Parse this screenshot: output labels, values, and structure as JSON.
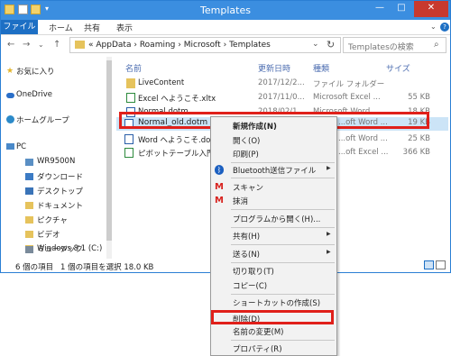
{
  "window": {
    "title": "Templates"
  },
  "ribbon": {
    "tabs": [
      "ファイル",
      "ホーム",
      "共有",
      "表示"
    ]
  },
  "address": {
    "prefix": "«",
    "path": [
      "AppData",
      "Roaming",
      "Microsoft",
      "Templates"
    ],
    "separator": "›"
  },
  "search": {
    "placeholder": "Templatesの検索"
  },
  "nav_pane": {
    "favorites": "お気に入り",
    "onedrive": "OneDrive",
    "homegroup": "ホームグループ",
    "pc": "PC",
    "pc_items": [
      "WR9500N",
      "ダウンロード",
      "デスクトップ",
      "ドキュメント",
      "ピクチャ",
      "ビデオ",
      "ミュージック",
      "Windows 8.1 (C:)"
    ]
  },
  "file_list": {
    "columns": {
      "name": "名前",
      "date": "更新日時",
      "type": "種類",
      "size": "サイズ"
    },
    "rows": [
      {
        "name": "LiveContent",
        "date": "2017/12/2...",
        "type": "ファイル フォルダー",
        "size": "",
        "icon": "folder-icon"
      },
      {
        "name": "Excel へようこそ.xltx",
        "date": "2017/11/0...",
        "type": "Microsoft Excel ...",
        "size": "55 KB",
        "icon": "excel-file-icon"
      },
      {
        "name": "Normal.dotm",
        "date": "2018/02/1...",
        "type": "Microsoft Word ...",
        "size": "18 KB",
        "icon": "word-file-icon"
      },
      {
        "name": "Normal_old.dotm",
        "date": "",
        "type": "...oft Word ...",
        "size": "19 KB",
        "icon": "word-file-icon",
        "selected": true
      },
      {
        "name": "Word へようこそ.dotx",
        "date": "",
        "type": "...oft Word ...",
        "size": "25 KB",
        "icon": "word-file-icon"
      },
      {
        "name": "ピボットテーブル入門.xltx",
        "date": "",
        "type": "...oft Excel ...",
        "size": "366 KB",
        "icon": "excel-file-icon"
      }
    ]
  },
  "status": {
    "count": "6 個の項目",
    "selection": "1 個の項目を選択  18.0 KB"
  },
  "context_menu": {
    "items": [
      {
        "label": "新規作成(N)",
        "bold": true
      },
      {
        "label": "開く(O)"
      },
      {
        "label": "印刷(P)"
      },
      {
        "label": "Bluetooth送信ファイル",
        "submenu": true,
        "icon": "bluetooth-icon"
      },
      {
        "label": "スキャン",
        "icon": "mcafee-icon"
      },
      {
        "label": "抹消",
        "icon": "mcafee-icon"
      },
      {
        "label": "プログラムから開く(H)..."
      },
      {
        "label": "共有(H)",
        "submenu": true
      },
      {
        "label": "送る(N)",
        "submenu": true
      },
      {
        "label": "切り取り(T)"
      },
      {
        "label": "コピー(C)"
      },
      {
        "label": "ショートカットの作成(S)"
      },
      {
        "label": "削除(D)",
        "highlighted": true
      },
      {
        "label": "名前の変更(M)"
      },
      {
        "label": "プロパティ(R)"
      }
    ]
  },
  "colors": {
    "title_bar": "#3b8ee0",
    "file_tab": "#1d6fc4",
    "selection": "#cce4f7",
    "highlight_frame": "#e0201a"
  }
}
